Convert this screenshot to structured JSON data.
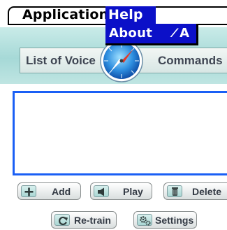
{
  "menubar": {
    "items": [
      {
        "label": "Application"
      },
      {
        "label": "Help"
      }
    ]
  },
  "help_menu": {
    "items": [
      {
        "label": "About",
        "shortcut": "A",
        "shortcut_glyph": "⁄"
      }
    ]
  },
  "header": {
    "left_label": "List of Voice",
    "right_label": "Commands",
    "logo_icon": "compass-icon"
  },
  "command_list": {
    "items": []
  },
  "buttons": {
    "add": {
      "label": "Add",
      "icon": "plus-icon"
    },
    "play": {
      "label": "Play",
      "icon": "speaker-icon"
    },
    "delete": {
      "label": "Delete",
      "icon": "trash-icon"
    },
    "retrain": {
      "label": "Re-train",
      "icon": "refresh-icon"
    },
    "settings": {
      "label": "Settings",
      "icon": "gears-icon"
    }
  },
  "colors": {
    "menu_highlight": "#0b10c8",
    "header_band": "#b4e0dd",
    "list_border": "#1a5ff5"
  }
}
